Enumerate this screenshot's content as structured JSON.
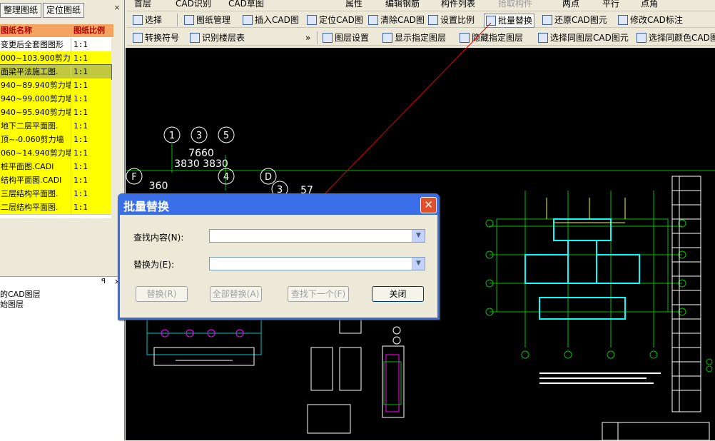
{
  "left_panel": {
    "tabs": [
      "整理图纸",
      "定位图纸"
    ],
    "close_glyph": "×",
    "grid": {
      "columns": [
        "图纸名称",
        "图纸比例"
      ],
      "rows": [
        {
          "name": "变更后全套图图形",
          "scale": "1:1"
        },
        {
          "name": "000~103.900剪力",
          "scale": "1:1"
        },
        {
          "name": "面梁平法施工图.",
          "scale": "1:1"
        },
        {
          "name": "940~89.940剪力墙",
          "scale": "1:1"
        },
        {
          "name": "940~99.000剪力墙",
          "scale": "1:1"
        },
        {
          "name": "940~95.940剪力墙",
          "scale": "1:1"
        },
        {
          "name": "地下二层平面图.",
          "scale": "1:1"
        },
        {
          "name": "顶~-0.060剪力墙",
          "scale": "1:1"
        },
        {
          "name": "060~14.940剪力墙",
          "scale": "1:1"
        },
        {
          "name": "桩平面图.CADI",
          "scale": "1:1"
        },
        {
          "name": "结构平面图.CADI",
          "scale": "1:1"
        },
        {
          "name": "三层结构平面图.",
          "scale": "1:1"
        },
        {
          "name": "二层结构平面图.",
          "scale": "1:1"
        }
      ]
    },
    "lower": {
      "pin": "ꟼ",
      "close": "×",
      "items": [
        "的CAD图层",
        "始图层"
      ]
    }
  },
  "toolbar_top": {
    "items": [
      "首层",
      "CAD识别",
      "CAD草图",
      "属性",
      "编辑钢筋",
      "构件列表",
      "拾取构件",
      "两点",
      "平行",
      "点角"
    ]
  },
  "toolbar_1": {
    "items": [
      "选择",
      "图纸管理",
      "插入CAD图",
      "定位CAD图",
      "清除CAD图",
      "设置比例",
      "批量替换",
      "还原CAD图元",
      "修改CAD标注"
    ]
  },
  "toolbar_2": {
    "items": [
      "转换符号",
      "识别楼层表",
      "图层设置",
      "显示指定图层",
      "隐藏指定图层",
      "选择同图层CAD图元",
      "选择同颜色CAD图元"
    ],
    "more": "»"
  },
  "canvas": {
    "axis_labels": [
      "1",
      "3",
      "5",
      "F",
      "4",
      "D",
      "3"
    ],
    "dims": [
      "7660",
      "3830",
      "3830",
      "360",
      "57"
    ]
  },
  "dialog": {
    "title": "批量替换",
    "close": "✕",
    "find_label": "查找内容(N):",
    "replace_label": "替换为(E):",
    "find_value": "",
    "replace_value": "",
    "buttons": {
      "replace": "替换(R)",
      "replace_all": "全部替换(A)",
      "find_next": "查找下一个(F)",
      "close": "关闭"
    },
    "combo_arrow": "▼"
  },
  "colors": {
    "arrow": "#e00000",
    "grid_highlight": "#ffff00",
    "selected_row": "#c0c840",
    "header": "#f4a460"
  }
}
